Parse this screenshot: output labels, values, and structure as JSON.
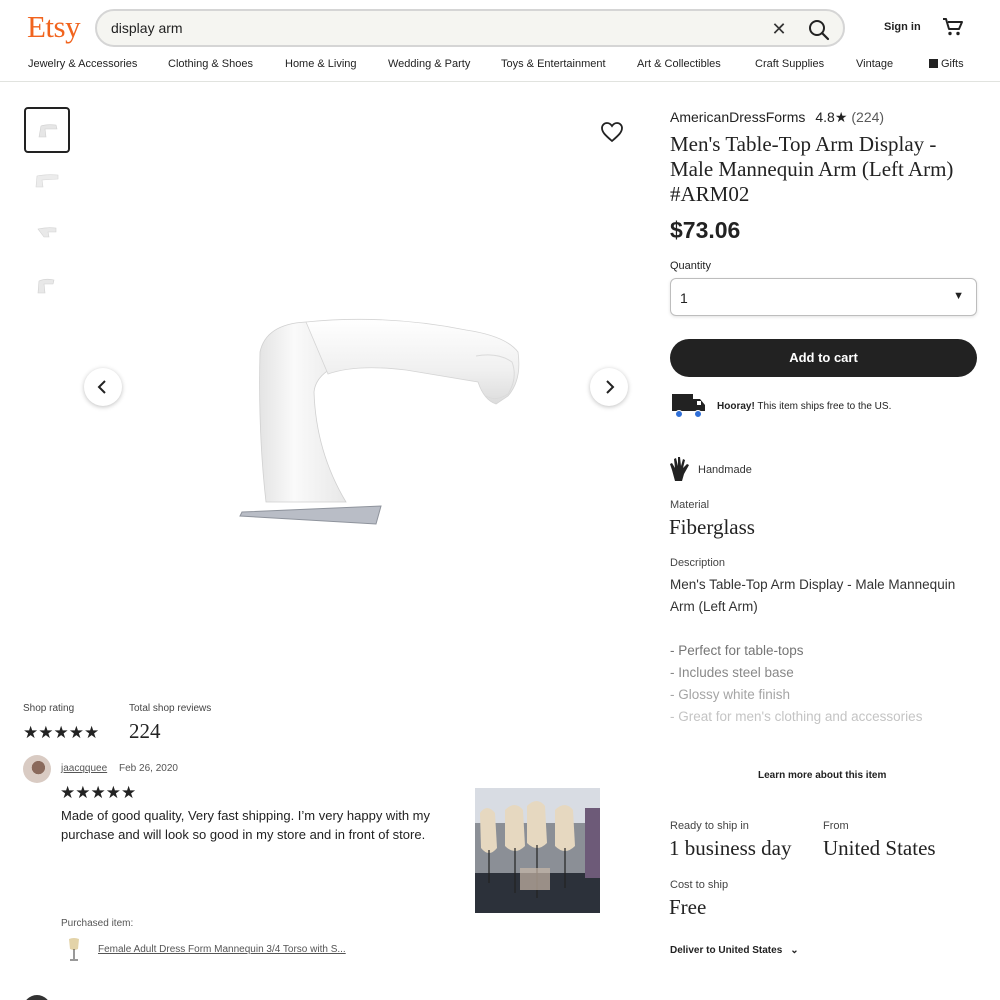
{
  "header": {
    "logo": "Etsy",
    "search_value": "display arm",
    "sign_in": "Sign in",
    "nav": [
      "Jewelry & Accessories",
      "Clothing & Shoes",
      "Home & Living",
      "Wedding & Party",
      "Toys & Entertainment",
      "Art & Collectibles",
      "Craft Supplies",
      "Vintage",
      "Gifts"
    ]
  },
  "listing": {
    "shop_name": "AmericanDressForms",
    "shop_rating": "4.8★",
    "shop_rating_count": "(224)",
    "title": "Men's Table-Top Arm Display - Male Mannequin Arm (Left Arm) #ARM02",
    "price": "$73.06",
    "quantity_label": "Quantity",
    "quantity_value": "1",
    "add_to_cart": "Add to cart",
    "shipping_bold": "Hooray!",
    "shipping_text": "This item ships free to the US.",
    "handmade": "Handmade",
    "material_label": "Material",
    "material_value": "Fiberglass",
    "description_label": "Description",
    "description_text": "Men's Table-Top Arm Display - Male Mannequin Arm (Left Arm)",
    "bullets": [
      "- Perfect for table-tops",
      "- Includes steel base",
      "- Glossy white finish",
      "- Great for men's clothing and accessories"
    ],
    "learn_more": "Learn more about this item",
    "ready_label": "Ready to ship in",
    "ready_value": "1 business day",
    "from_label": "From",
    "from_value": "United States",
    "cost_label": "Cost to ship",
    "cost_value": "Free",
    "deliver_to": "Deliver to United States"
  },
  "reviews": {
    "shop_rating_label": "Shop rating",
    "total_label": "Total shop reviews",
    "total_value": "224",
    "shop_stars": 5,
    "items": [
      {
        "reviewer": "jaacqquee",
        "date": "Feb 26, 2020",
        "stars": 5,
        "text": "Made of good quality, Very fast shipping. I’m very happy with my purchase and will look so good in my store and in front of store.",
        "purchased_label": "Purchased item:",
        "purchased_item": "Female Adult Dress Form Mannequin 3/4 Torso with S..."
      }
    ]
  },
  "colors": {
    "brand": "#f1641e",
    "button": "#222222"
  }
}
